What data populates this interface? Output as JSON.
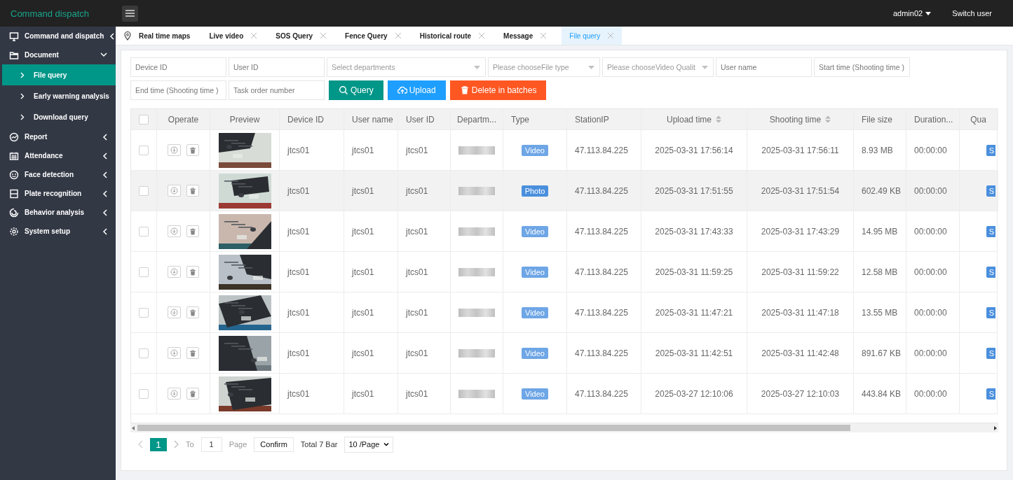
{
  "top_bar": {
    "title": "Command dispatch",
    "user": "admin02",
    "switch_user": "Switch user"
  },
  "sidebar": {
    "items": [
      {
        "label": "Command and dispatch",
        "expanded": false
      },
      {
        "label": "Document",
        "expanded": true,
        "children": [
          {
            "label": "File query",
            "selected": true
          },
          {
            "label": "Early warning analysis",
            "selected": false
          },
          {
            "label": "Download query",
            "selected": false
          }
        ]
      },
      {
        "label": "Report",
        "expanded": false
      },
      {
        "label": "Attendance",
        "expanded": false
      },
      {
        "label": "Face detection",
        "expanded": false
      },
      {
        "label": "Plate recognition",
        "expanded": false
      },
      {
        "label": "Behavior analysis",
        "expanded": false
      },
      {
        "label": "System setup",
        "expanded": false
      }
    ]
  },
  "tabs": [
    {
      "label": "Real time maps",
      "selected": false,
      "closable": false
    },
    {
      "label": "Live video",
      "selected": false,
      "closable": true
    },
    {
      "label": "SOS Query",
      "selected": false,
      "closable": true
    },
    {
      "label": "Fence Query",
      "selected": false,
      "closable": true
    },
    {
      "label": "Historical route",
      "selected": false,
      "closable": true
    },
    {
      "label": "Message",
      "selected": false,
      "closable": true
    },
    {
      "label": "File query",
      "selected": true,
      "closable": true
    }
  ],
  "filters": {
    "fields": [
      {
        "kind": "text",
        "placeholder": "Device ID"
      },
      {
        "kind": "text",
        "placeholder": "User ID"
      },
      {
        "kind": "select",
        "placeholder": "Select departments"
      },
      {
        "kind": "select",
        "placeholder": "Please chooseFile type"
      },
      {
        "kind": "select",
        "placeholder": "Please chooseVideo Qualit"
      },
      {
        "kind": "text",
        "placeholder": "User name"
      },
      {
        "kind": "text",
        "placeholder": "Start time (Shooting time )"
      },
      {
        "kind": "text",
        "placeholder": "End time (Shooting time )"
      },
      {
        "kind": "text",
        "placeholder": "Task order number"
      }
    ],
    "buttons": [
      {
        "kind": "query",
        "label": "Query"
      },
      {
        "kind": "upload",
        "label": "Upload"
      },
      {
        "kind": "delete",
        "label": "Delete in batches"
      }
    ]
  },
  "table": {
    "select_all": false,
    "columns": [
      {
        "label": "Operate",
        "sortable": false
      },
      {
        "label": "Preview",
        "sortable": false
      },
      {
        "label": "Device ID",
        "sortable": false
      },
      {
        "label": "User name",
        "sortable": false
      },
      {
        "label": "User ID",
        "sortable": false
      },
      {
        "label": "Departm...",
        "sortable": false
      },
      {
        "label": "Type",
        "sortable": false
      },
      {
        "label": "StationIP",
        "sortable": false
      },
      {
        "label": "Upload time",
        "sortable": true
      },
      {
        "label": "Shooting time",
        "sortable": true
      },
      {
        "label": "File size",
        "sortable": false
      },
      {
        "label": "Duration...",
        "sortable": false
      },
      {
        "label": "Qua",
        "sortable": false
      }
    ],
    "rows": [
      {
        "checked": false,
        "highlighted": false,
        "device_id": "jtcs01",
        "user_name": "jtcs01",
        "user_id": "jtcs01",
        "type": {
          "kind": "video",
          "label": "Video"
        },
        "station_ip": "47.113.84.225",
        "upload_time": "2025-03-31 17:56:14",
        "shooting_time": "2025-03-31 17:56:11",
        "file_size": "8.93 MB",
        "duration": "00:00:00",
        "quality": "S"
      },
      {
        "checked": false,
        "highlighted": true,
        "device_id": "jtcs01",
        "user_name": "jtcs01",
        "user_id": "jtcs01",
        "type": {
          "label": "Photo"
        },
        "station_ip": "47.113.84.225",
        "upload_time": "2025-03-31 17:51:55",
        "shooting_time": "2025-03-31 17:51:54",
        "file_size": "602.49 KB",
        "duration": "00:00:00",
        "quality": "S"
      },
      {
        "checked": false,
        "highlighted": false,
        "device_id": "jtcs01",
        "user_name": "jtcs01",
        "user_id": "jtcs01",
        "type": {
          "kind": "video",
          "label": "Video"
        },
        "station_ip": "47.113.84.225",
        "upload_time": "2025-03-31 17:43:33",
        "shooting_time": "2025-03-31 17:43:29",
        "file_size": "14.95 MB",
        "duration": "00:00:00",
        "quality": "S"
      },
      {
        "checked": false,
        "highlighted": false,
        "device_id": "jtcs01",
        "user_name": "jtcs01",
        "user_id": "jtcs01",
        "type": {
          "kind": "video",
          "label": "Video"
        },
        "station_ip": "47.113.84.225",
        "upload_time": "2025-03-31 11:59:25",
        "shooting_time": "2025-03-31 11:59:22",
        "file_size": "12.58 MB",
        "duration": "00:00:00",
        "quality": "S"
      },
      {
        "checked": false,
        "highlighted": false,
        "device_id": "jtcs01",
        "user_name": "jtcs01",
        "user_id": "jtcs01",
        "type": {
          "kind": "video",
          "label": "Video"
        },
        "station_ip": "47.113.84.225",
        "upload_time": "2025-03-31 11:47:21",
        "shooting_time": "2025-03-31 11:47:18",
        "file_size": "13.55 MB",
        "duration": "00:00:00",
        "quality": "S"
      },
      {
        "checked": false,
        "highlighted": false,
        "device_id": "jtcs01",
        "user_name": "jtcs01",
        "user_id": "jtcs01",
        "type": {
          "kind": "video",
          "label": "Video"
        },
        "station_ip": "47.113.84.225",
        "upload_time": "2025-03-31 11:42:51",
        "shooting_time": "2025-03-31 11:42:48",
        "file_size": "891.67 KB",
        "duration": "00:00:00",
        "quality": "S"
      },
      {
        "checked": false,
        "highlighted": false,
        "device_id": "jtcs01",
        "user_name": "jtcs01",
        "user_id": "jtcs01",
        "type": {
          "kind": "video",
          "label": "Video"
        },
        "station_ip": "47.113.84.225",
        "upload_time": "2025-03-27 12:10:06",
        "shooting_time": "2025-03-27 12:10:03",
        "file_size": "443.84 KB",
        "duration": "00:00:00",
        "quality": "S"
      }
    ]
  },
  "pagination": {
    "pages": [
      {
        "label": "1",
        "selected": true
      }
    ],
    "goto_label": "To",
    "goto_value": "1",
    "page_label": "Page",
    "confirm": "Confirm",
    "total": "Total 7 Bar",
    "page_size": "10 /Page"
  }
}
